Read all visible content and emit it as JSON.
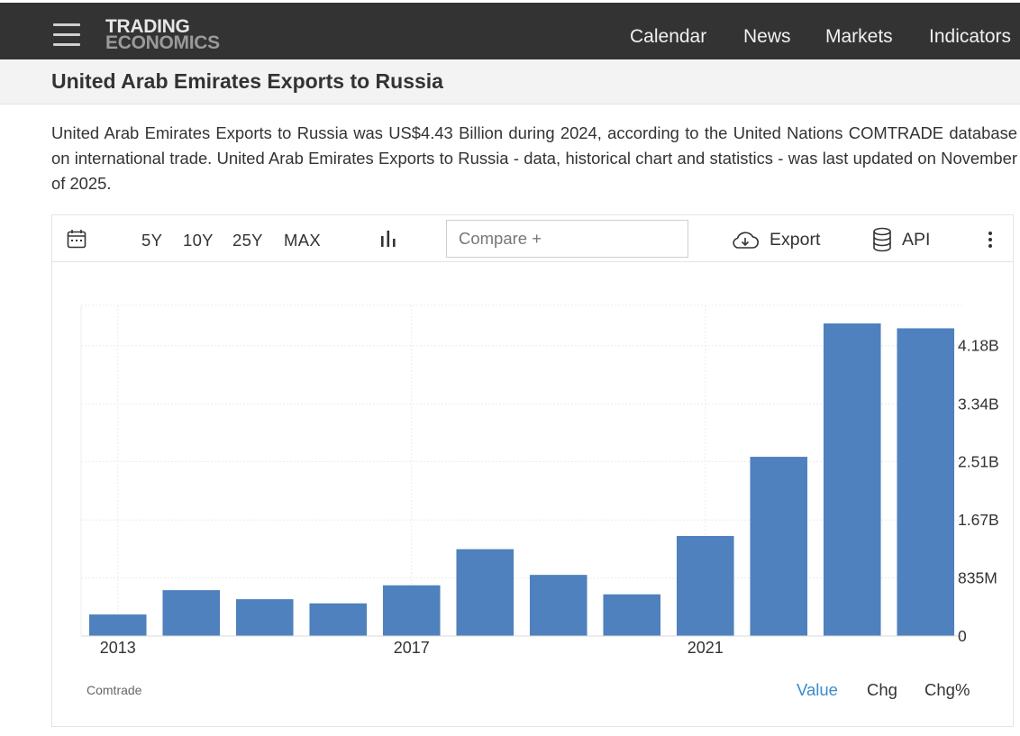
{
  "header": {
    "logo_line1": "TRADING",
    "logo_line2": "ECONOMICS",
    "nav": [
      "Calendar",
      "News",
      "Markets",
      "Indicators"
    ]
  },
  "page": {
    "title": "United Arab Emirates Exports to Russia",
    "description": "United Arab Emirates Exports to Russia was US$4.43 Billion during 2024, according to the United Nations COMTRADE database on international trade. United Arab Emirates Exports to Russia - data, historical chart and statistics - was last updated on November of 2025."
  },
  "toolbar": {
    "ranges": [
      "5Y",
      "10Y",
      "25Y",
      "MAX"
    ],
    "compare_placeholder": "Compare +",
    "export_label": "Export",
    "api_label": "API"
  },
  "chart_footer": {
    "source": "Comtrade",
    "tabs": [
      "Value",
      "Chg",
      "Chg%"
    ],
    "active_tab": "Value"
  },
  "colors": {
    "bar": "#4e81bd",
    "active_tab": "#3a8ccd",
    "topbar": "#333333"
  },
  "icons": {
    "calendar": "calendar-icon",
    "chart_type": "bar-chart-icon",
    "export": "cloud-download-icon",
    "api": "database-icon",
    "more": "more-vertical-icon",
    "menu": "hamburger-menu-icon"
  },
  "chart_data": {
    "type": "bar",
    "categories": [
      "2013",
      "2014",
      "2015",
      "2016",
      "2017",
      "2018",
      "2019",
      "2020",
      "2021",
      "2022",
      "2023",
      "2024"
    ],
    "values": [
      0.31,
      0.66,
      0.53,
      0.47,
      0.73,
      1.25,
      0.88,
      0.6,
      1.44,
      2.58,
      4.5,
      4.43
    ],
    "x_tick_labels": [
      "2013",
      "2017",
      "2021"
    ],
    "y_ticks": [
      0,
      0.835,
      1.67,
      2.51,
      3.34,
      4.18
    ],
    "y_tick_labels": [
      "0",
      "835M",
      "1.67B",
      "2.51B",
      "3.34B",
      "4.18B"
    ],
    "ylim": [
      0,
      4.76
    ],
    "unit": "USD Billion",
    "grid": true,
    "y_axis_position": "right"
  }
}
